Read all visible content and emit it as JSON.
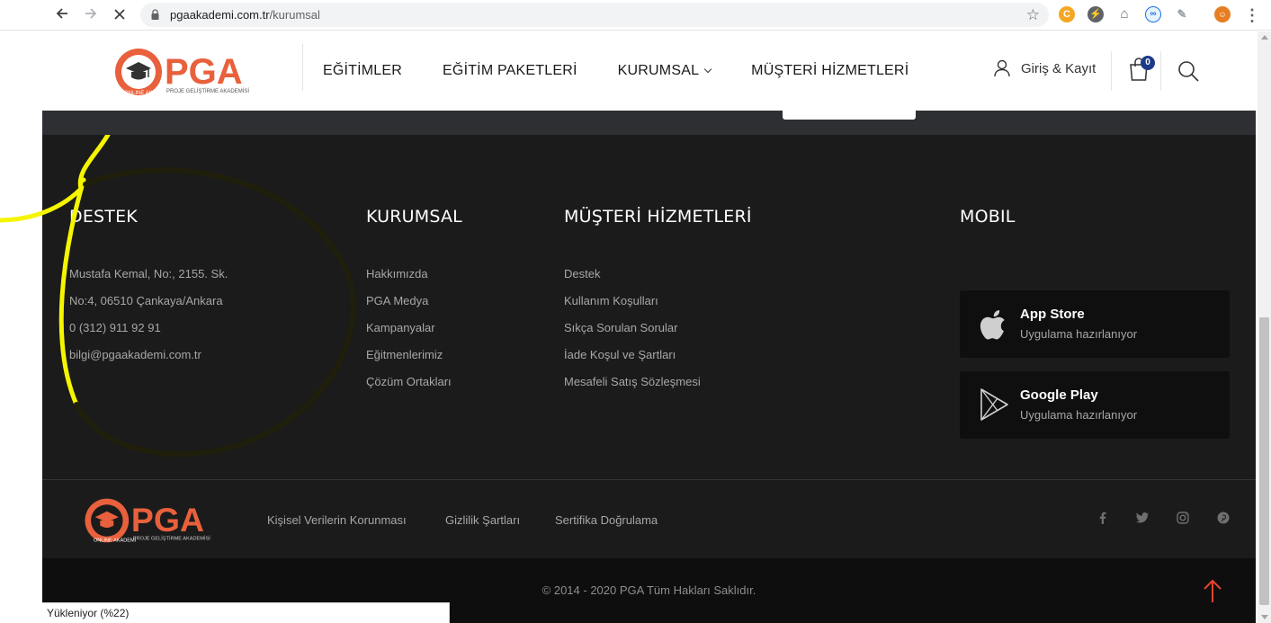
{
  "browser": {
    "url_host": "pgaakademi.com.tr",
    "url_path": "/kurumsal",
    "status_text": "Yükleniyor (%22)"
  },
  "header": {
    "logo_text": "PGA",
    "logo_tagline": "PROJE GELİŞTİRME AKADEMİSİ",
    "logo_badge": "ONLINE AKADEMİ",
    "menu": [
      {
        "label": "EĞİTİMLER"
      },
      {
        "label": "EĞİTİM PAKETLERİ"
      },
      {
        "label": "KURUMSAL"
      },
      {
        "label": "MÜŞTERİ HİZMETLERİ"
      }
    ],
    "login_label": "Giriş & Kayıt",
    "cart_count": "0"
  },
  "footer": {
    "destek": {
      "title": "DESTEK",
      "lines": [
        "Mustafa Kemal, No:, 2155. Sk.",
        "No:4, 06510 Çankaya/Ankara",
        "0 (312) 911 92 91",
        "bilgi@pgaakademi.com.tr"
      ]
    },
    "kurumsal": {
      "title": "KURUMSAL",
      "links": [
        "Hakkımızda",
        "PGA Medya",
        "Kampanyalar",
        "Eğitmenlerimiz",
        "Çözüm Ortakları"
      ]
    },
    "musteri": {
      "title": "MÜŞTERİ HİZMETLERİ",
      "links": [
        "Destek",
        "Kullanım Koşulları",
        "Sıkça Sorulan Sorular",
        "İade Koşul ve Şartları",
        "Mesafeli Satış Sözleşmesi"
      ]
    },
    "mobil": {
      "title": "MOBIL",
      "apps": [
        {
          "name": "App Store",
          "sub": "Uygulama hazırlanıyor",
          "icon": "apple-icon"
        },
        {
          "name": "Google Play",
          "sub": "Uygulama hazırlanıyor",
          "icon": "google-play-icon"
        }
      ]
    },
    "legal_links": [
      "Kişisel Verilerin Korunması",
      "Gizlilik Şartları",
      "Sertifika Doğrulama"
    ],
    "social": [
      "facebook-icon",
      "twitter-icon",
      "instagram-icon",
      "pinterest-icon"
    ],
    "copyright": "© 2014 - 2020 PGA Tüm Hakları Saklıdır."
  },
  "colors": {
    "brand_orange": "#e8603c",
    "footer_bg": "#1b1b1b",
    "annotation_yellow": "#f5f500",
    "to_top_red": "#e8452c"
  }
}
